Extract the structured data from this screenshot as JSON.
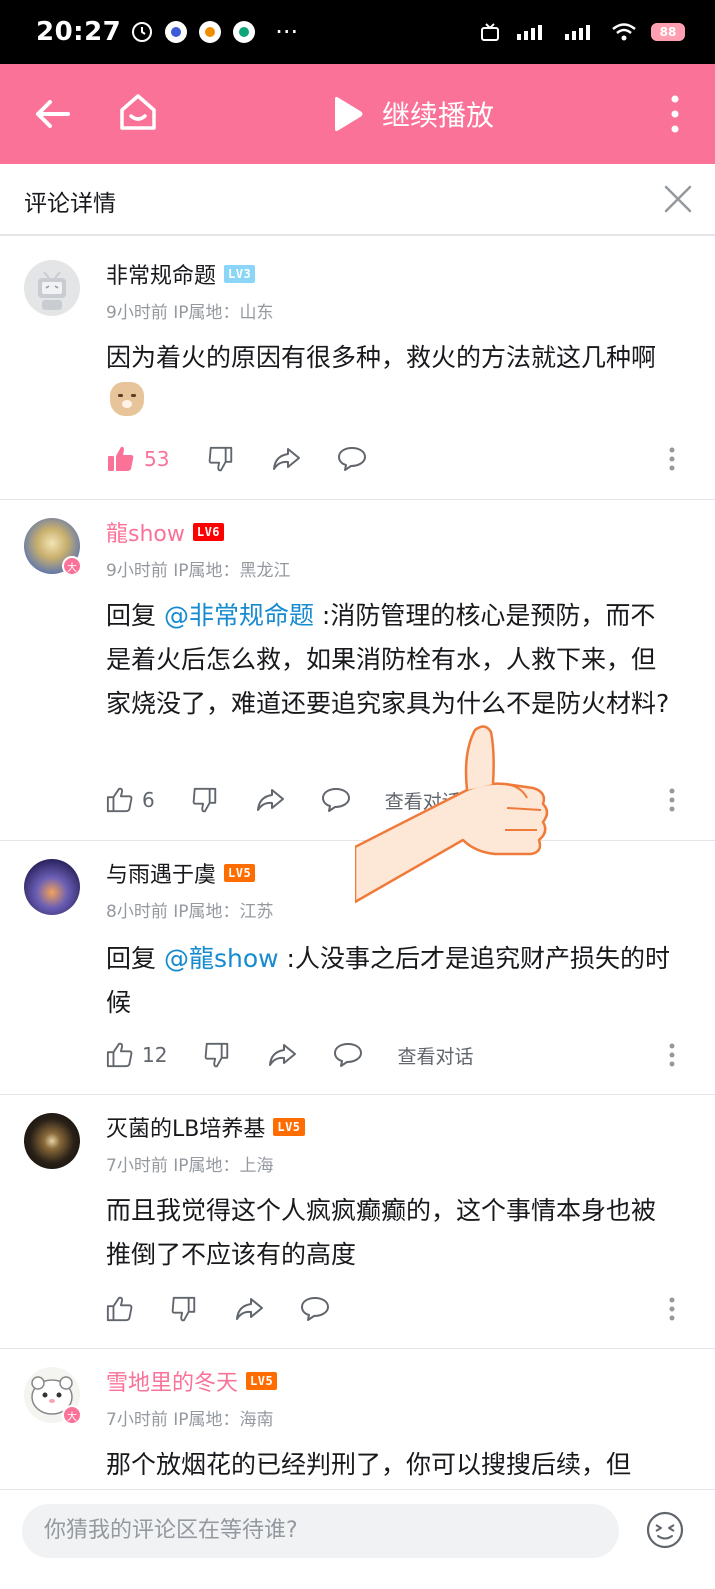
{
  "status_bar": {
    "time": "20:27",
    "battery": "88"
  },
  "header": {
    "play_label": "继续播放"
  },
  "subheader": {
    "title": "评论详情"
  },
  "colors": {
    "brand_pink": "#fb7299",
    "mention_blue": "#178bcf",
    "lv3": "#8bd5f9",
    "lv5": "#ff6c00",
    "lv6": "#ff0000"
  },
  "comments": [
    {
      "username": "非常规命题",
      "level": "LV3",
      "meta": "9小时前 IP属地：山东",
      "text": "因为着火的原因有很多种，救火的方法就这几种啊",
      "likes": "53",
      "liked": true
    },
    {
      "username": "龍show",
      "level": "LV6",
      "meta": "9小时前 IP属地：黑龙江",
      "reply_prefix": "回复 ",
      "mention": "@非常规命题",
      "text": " :消防管理的核心是预防，而不是着火后怎么救，如果消防栓有水，人救下来，但家烧没了，难道还要追究家具为什么不是防火材料?",
      "likes": "6",
      "view_conversation": "查看对话"
    },
    {
      "username": "与雨遇于虞",
      "level": "LV5",
      "meta": "8小时前 IP属地：江苏",
      "reply_prefix": "回复 ",
      "mention": "@龍show",
      "text": " :人没事之后才是追究财产损失的时候",
      "likes": "12",
      "view_conversation": "查看对话"
    },
    {
      "username": "灭菌的LB培养基",
      "level": "LV5",
      "meta": "7小时前 IP属地：上海",
      "text": "而且我觉得这个人疯疯癫癫的，这个事情本身也被推倒了不应该有的高度"
    },
    {
      "username": "雪地里的冬天",
      "level": "LV5",
      "meta": "7小时前 IP属地：海南",
      "text": "那个放烟花的已经判刑了，你可以搜搜后续，但"
    }
  ],
  "bottom": {
    "placeholder": "你猜我的评论区在等待谁?"
  }
}
